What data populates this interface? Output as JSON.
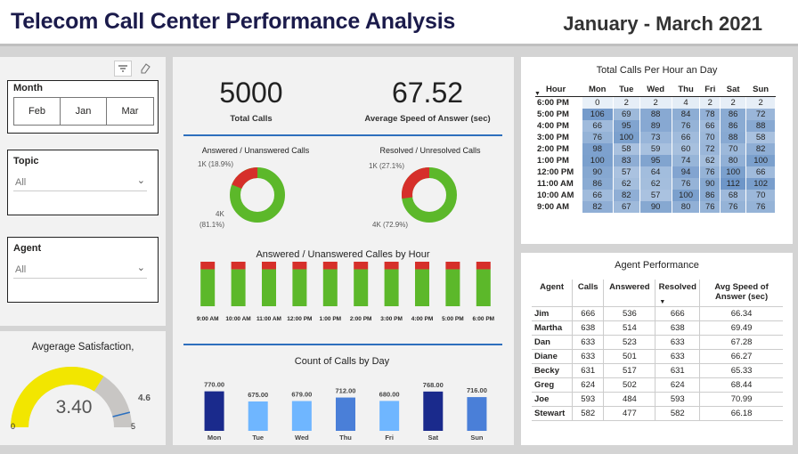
{
  "header": {
    "title": "Telecom Call Center Performance Analysis",
    "period": "January - March 2021"
  },
  "filters": {
    "month": {
      "label": "Month",
      "options": [
        "Feb",
        "Jan",
        "Mar"
      ]
    },
    "topic": {
      "label": "Topic",
      "value": "All"
    },
    "agent": {
      "label": "Agent",
      "value": "All"
    }
  },
  "satisfaction": {
    "title": "Avgerage Satisfaction,",
    "value": "3.40",
    "value_num": 3.4,
    "min": "0",
    "max": "5",
    "target": "4.6",
    "target_num": 4.6,
    "fill_color": "#f2e600",
    "track_color": "#c8c6c4"
  },
  "kpis": {
    "total_calls": {
      "value": "5000",
      "label": "Total Calls"
    },
    "avg_speed": {
      "value": "67.52",
      "label": "Average Speed of Answer (sec)"
    }
  },
  "donuts": {
    "answered": {
      "title": "Answered / Unanswered Calls",
      "small_label": "1K (18.9%)",
      "big_label_1": "4K",
      "big_label_2": "(81.1%)",
      "small_pct": 18.9
    },
    "resolved": {
      "title": "Resolved / Unresolved Calls",
      "small_label": "1K (27.1%)",
      "big_label": "4K (72.9%)",
      "small_pct": 27.1
    },
    "colors": {
      "green": "#5cb82a",
      "red": "#d62f2a"
    }
  },
  "chart_data": [
    {
      "type": "bar",
      "title": "Answered / Unanswered Calles by Hour",
      "categories": [
        "9:00 AM",
        "10:00 AM",
        "11:00 AM",
        "12:00 PM",
        "1:00 PM",
        "2:00 PM",
        "3:00 PM",
        "4:00 PM",
        "5:00 PM",
        "6:00 PM"
      ],
      "series": [
        {
          "name": "Answered",
          "values": [
            405,
            402,
            405,
            405,
            405,
            405,
            405,
            405,
            405,
            405
          ]
        },
        {
          "name": "Unanswered",
          "values": [
            95,
            95,
            95,
            95,
            95,
            95,
            95,
            95,
            95,
            95
          ]
        }
      ],
      "stacked": true
    },
    {
      "type": "bar",
      "title": "Count of Calls by Day",
      "categories": [
        "Mon",
        "Tue",
        "Wed",
        "Thu",
        "Fri",
        "Sat",
        "Sun"
      ],
      "values": [
        770,
        675,
        679,
        712,
        680,
        768,
        716
      ],
      "value_labels": [
        "770.00",
        "675.00",
        "679.00",
        "712.00",
        "680.00",
        "768.00",
        "716.00"
      ],
      "colors": [
        "#1a2a8c",
        "#6fb6ff",
        "#6fb6ff",
        "#4a7fd8",
        "#6fb6ff",
        "#1a2a8c",
        "#4a7fd8"
      ]
    }
  ],
  "hour_table": {
    "title": "Total Calls Per Hour an Day",
    "columns": [
      "Hour",
      "Mon",
      "Tue",
      "Wed",
      "Thu",
      "Fri",
      "Sat",
      "Sun"
    ],
    "rows": [
      [
        "6:00 PM",
        "0",
        "2",
        "2",
        "4",
        "2",
        "2",
        "2"
      ],
      [
        "5:00 PM",
        "106",
        "69",
        "88",
        "84",
        "78",
        "86",
        "72"
      ],
      [
        "4:00 PM",
        "66",
        "95",
        "89",
        "76",
        "66",
        "86",
        "88"
      ],
      [
        "3:00 PM",
        "76",
        "100",
        "73",
        "66",
        "70",
        "88",
        "58"
      ],
      [
        "2:00 PM",
        "98",
        "58",
        "59",
        "60",
        "72",
        "70",
        "82"
      ],
      [
        "1:00 PM",
        "100",
        "83",
        "95",
        "74",
        "62",
        "80",
        "100"
      ],
      [
        "12:00 PM",
        "90",
        "57",
        "64",
        "94",
        "76",
        "100",
        "66"
      ],
      [
        "11:00 AM",
        "86",
        "62",
        "62",
        "76",
        "90",
        "112",
        "102"
      ],
      [
        "10:00 AM",
        "66",
        "82",
        "57",
        "100",
        "86",
        "68",
        "70"
      ],
      [
        "9:00 AM",
        "82",
        "67",
        "90",
        "80",
        "76",
        "76",
        "76"
      ]
    ]
  },
  "agent_table": {
    "title": "Agent Performance",
    "columns": [
      "Agent",
      "Calls",
      "Answered",
      "Resolved",
      "Avg Speed of Answer (sec)"
    ],
    "rows": [
      [
        "Jim",
        "666",
        "536",
        "666",
        "66.34"
      ],
      [
        "Martha",
        "638",
        "514",
        "638",
        "69.49"
      ],
      [
        "Dan",
        "633",
        "523",
        "633",
        "67.28"
      ],
      [
        "Diane",
        "633",
        "501",
        "633",
        "66.27"
      ],
      [
        "Becky",
        "631",
        "517",
        "631",
        "65.33"
      ],
      [
        "Greg",
        "624",
        "502",
        "624",
        "68.44"
      ],
      [
        "Joe",
        "593",
        "484",
        "593",
        "70.99"
      ],
      [
        "Stewart",
        "582",
        "477",
        "582",
        "66.18"
      ]
    ]
  }
}
